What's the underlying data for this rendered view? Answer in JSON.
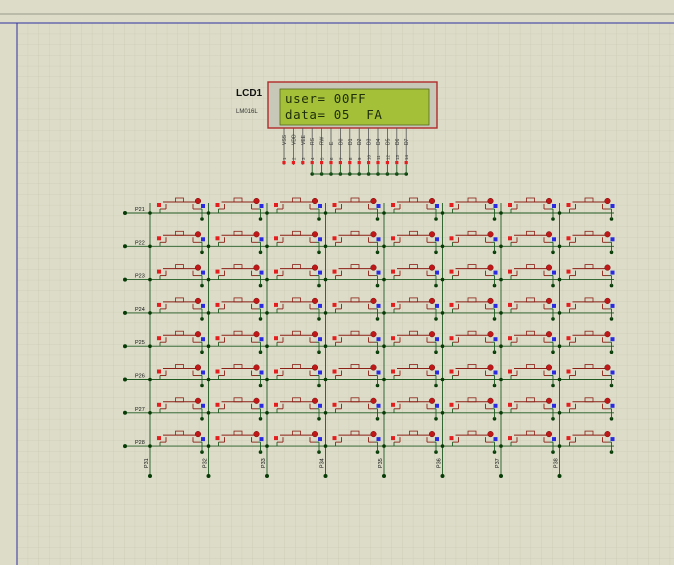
{
  "theme": {
    "sheet_bg": "#dcdcc8",
    "grid_minor": "#c6c6b0",
    "grid_major": "#b6b6a0",
    "border_blue": "#3030a0",
    "wire": "#1f5a22",
    "junction": "#063b06",
    "switch_stroke": "#8c1f16",
    "pin_red": "#e41e1e",
    "pin_blue": "#2a2ae0",
    "lcd_frame": "#b22a2a",
    "lcd_screen": "#a4bf38"
  },
  "lcd": {
    "designator": "LCD1",
    "model": "LM016L",
    "line1": "user= 00FF",
    "line2": "data= 05  FA",
    "pins": [
      {
        "name": "VSS",
        "num": "1"
      },
      {
        "name": "VDD",
        "num": "2"
      },
      {
        "name": "VEE",
        "num": "3"
      },
      {
        "name": "RS",
        "num": "4"
      },
      {
        "name": "RW",
        "num": "5"
      },
      {
        "name": "E",
        "num": "6"
      },
      {
        "name": "D0",
        "num": "7"
      },
      {
        "name": "D1",
        "num": "8"
      },
      {
        "name": "D2",
        "num": "9"
      },
      {
        "name": "D3",
        "num": "10"
      },
      {
        "name": "D4",
        "num": "11"
      },
      {
        "name": "D5",
        "num": "12"
      },
      {
        "name": "D6",
        "num": "13"
      },
      {
        "name": "D7",
        "num": "14"
      }
    ]
  },
  "keypad": {
    "rows": 8,
    "cols": 8,
    "row_labels": [
      "P21",
      "P22",
      "P23",
      "P24",
      "P25",
      "P26",
      "P27",
      "P28"
    ],
    "col_labels": [
      "P31",
      "P32",
      "P33",
      "P34",
      "P35",
      "P36",
      "P37",
      "P38"
    ]
  }
}
